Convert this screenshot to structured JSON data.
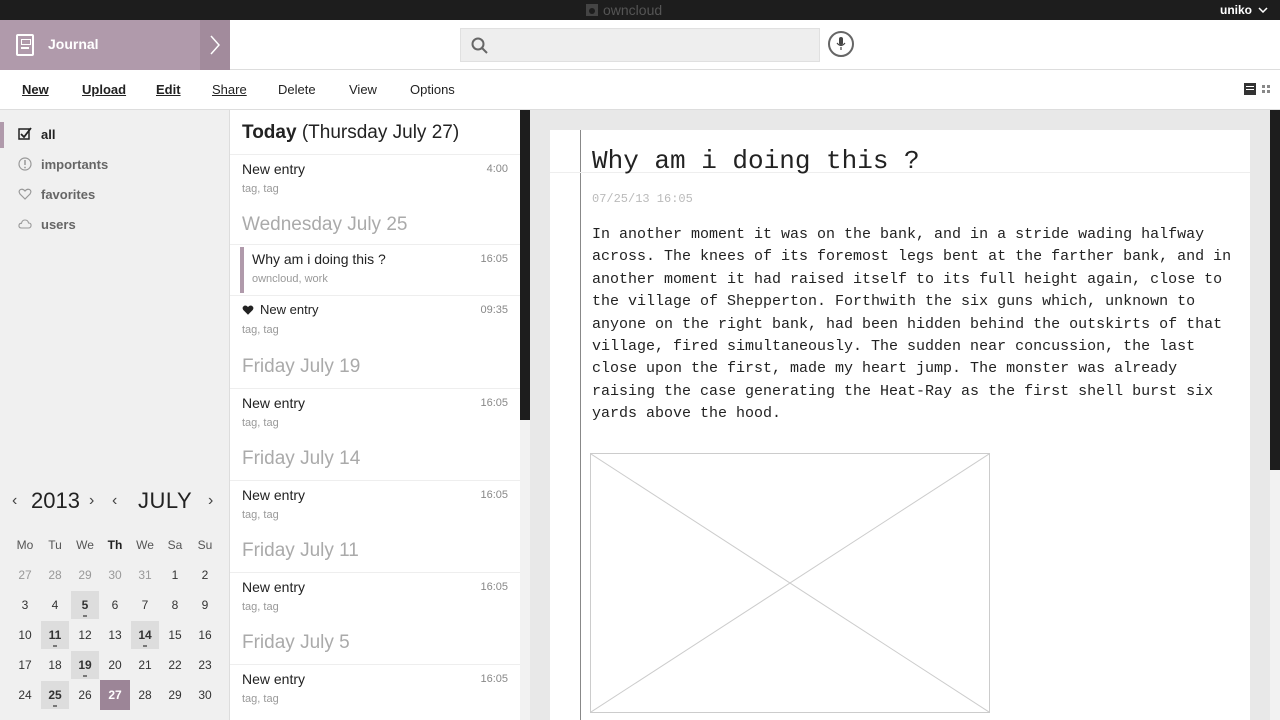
{
  "topbar": {
    "brand": "owncloud",
    "user": "uniko"
  },
  "app": {
    "title": "Journal"
  },
  "search": {
    "placeholder": "",
    "value": ""
  },
  "toolbar": {
    "new": "New",
    "upload": "Upload",
    "edit": "Edit",
    "share": "Share",
    "delete": "Delete",
    "view": "View",
    "options": "Options"
  },
  "sidebar": {
    "items": [
      {
        "label": "all",
        "icon": "checkbox-icon"
      },
      {
        "label": "importants",
        "icon": "exclamation-icon"
      },
      {
        "label": "favorites",
        "icon": "heart-icon"
      },
      {
        "label": "users",
        "icon": "cloud-icon"
      }
    ]
  },
  "calendar": {
    "year": "2013",
    "month": "JULY",
    "dow": [
      "Mo",
      "Tu",
      "We",
      "Th",
      "We",
      "Sa",
      "Su"
    ],
    "weeks": [
      [
        "27",
        "28",
        "29",
        "30",
        "31",
        "1",
        "2"
      ],
      [
        "3",
        "4",
        "5",
        "6",
        "7",
        "8",
        "9"
      ],
      [
        "10",
        "11",
        "12",
        "13",
        "14",
        "15",
        "16"
      ],
      [
        "17",
        "18",
        "19",
        "20",
        "21",
        "22",
        "23"
      ],
      [
        "24",
        "25",
        "26",
        "27",
        "28",
        "29",
        "30"
      ]
    ]
  },
  "list": {
    "today_bold": "Today",
    "today_rest": "(Thursday July 27)",
    "groups": [
      {
        "date": "Wednesday July 25"
      },
      {
        "date": "Friday July 19"
      },
      {
        "date": "Friday July 14"
      },
      {
        "date": "Friday July 11"
      },
      {
        "date": "Friday July 5"
      }
    ],
    "entries": [
      {
        "title": "New entry",
        "tags": "tag, tag",
        "time": "4:00"
      },
      {
        "title": "Why am i doing this ?",
        "tags": "owncloud, work",
        "time": "16:05"
      },
      {
        "title": "New entry",
        "tags": "tag, tag",
        "time": "09:35"
      },
      {
        "title": "New entry",
        "tags": "tag, tag",
        "time": "16:05"
      },
      {
        "title": "New entry",
        "tags": "tag, tag",
        "time": "16:05"
      },
      {
        "title": "New entry",
        "tags": "tag, tag",
        "time": "16:05"
      },
      {
        "title": "New entry",
        "tags": "tag, tag",
        "time": "16:05"
      }
    ]
  },
  "detail": {
    "title": "Why am i doing this ?",
    "timestamp": "07/25/13 16:05",
    "body": "In another moment it was on the bank, and in a stride wading halfway across.  The knees of its foremost legs bent at the farther bank, and in another moment it had raised itself to its full height again, close to the village of Shepperton.  Forthwith the six guns which, unknown to anyone on the right bank, had been hidden behind the outskirts of that village, fired simultaneously.  The sudden near concussion, the last close upon the first, made my heart jump.  The monster was already raising the case generating the Heat-Ray as the first shell burst six yards above the hood."
  },
  "colors": {
    "accent": "#b09aab",
    "today": "#9c8597",
    "topbar": "#1d1d1d"
  }
}
